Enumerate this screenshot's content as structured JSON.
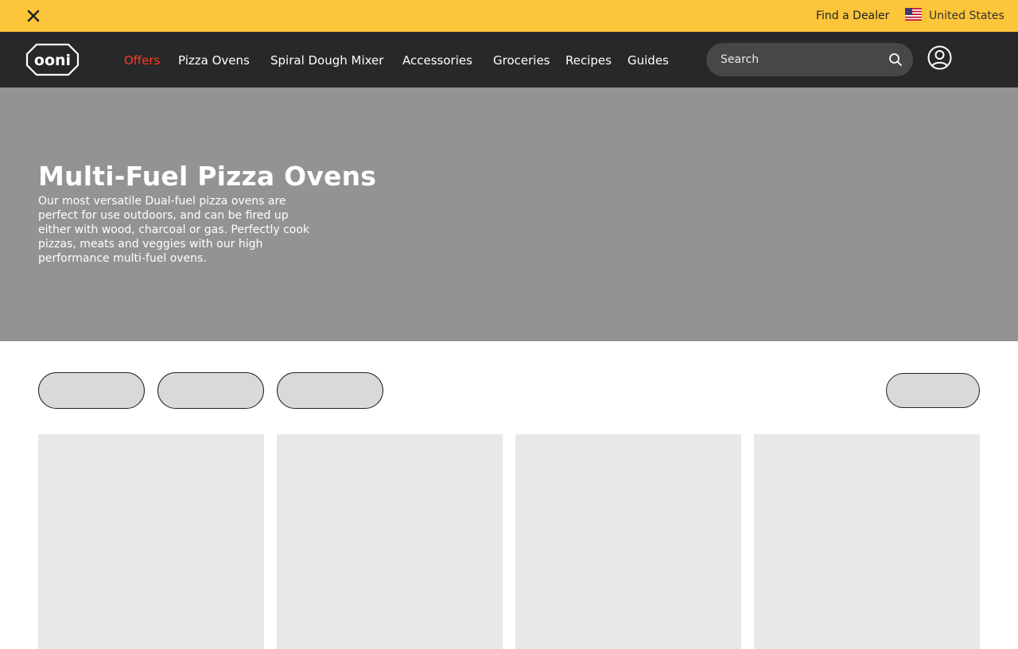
{
  "topbar": {
    "close_icon": "close-icon",
    "find_dealer": "Find a Dealer",
    "locale_flag_icon": "us-flag-icon",
    "locale": "United States",
    "bg_color": "#fdc53a"
  },
  "nav": {
    "logo_text": "ooni",
    "items": [
      {
        "label": "Offers",
        "color": "#ff3b1f"
      },
      {
        "label": "Pizza Ovens"
      },
      {
        "label": "Spiral Dough Mixer"
      },
      {
        "label": "Accessories"
      },
      {
        "label": "Groceries"
      },
      {
        "label": "Recipes"
      },
      {
        "label": "Guides"
      }
    ],
    "search": {
      "placeholder": "Search",
      "icon": "search-icon"
    },
    "account_icon": "user-account-icon",
    "bg_color": "#27282a"
  },
  "hero": {
    "title": "Multi-Fuel Pizza Ovens",
    "description": "Our most versatile Dual-fuel pizza ovens are perfect for use outdoors, and can be fired up either with wood, charcoal or gas. Perfectly cook pizzas, meats and veggies with our high performance multi-fuel ovens.",
    "bg_color": "#939393"
  }
}
